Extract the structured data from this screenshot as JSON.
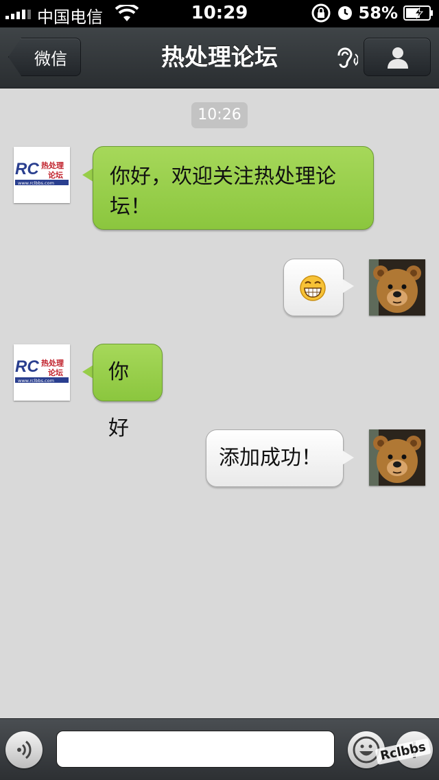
{
  "status_bar": {
    "carrier": "中国电信",
    "time": "10:29",
    "battery": "58%"
  },
  "nav": {
    "back_label": "微信",
    "title": "热处理论坛"
  },
  "chat": {
    "timestamp": "10:26",
    "messages": [
      {
        "sender": "rclbbs",
        "text": "你好，欢迎关注热处理论坛！"
      },
      {
        "sender": "me",
        "text": "😁"
      },
      {
        "sender": "rclbbs",
        "text": "你好"
      },
      {
        "sender": "me",
        "text": "添加成功！"
      }
    ]
  },
  "logo": {
    "letters": "RC",
    "chinese_top": "热处理",
    "chinese_bottom": "论坛",
    "url": "www.rclbbs.com"
  },
  "input": {
    "placeholder": ""
  },
  "watermark": "Rclbbs",
  "colors": {
    "green_bubble": "#97cd49",
    "white_bubble": "#f4f4f4",
    "nav_bg": "#34383b",
    "chat_bg": "#d9d9d9"
  }
}
